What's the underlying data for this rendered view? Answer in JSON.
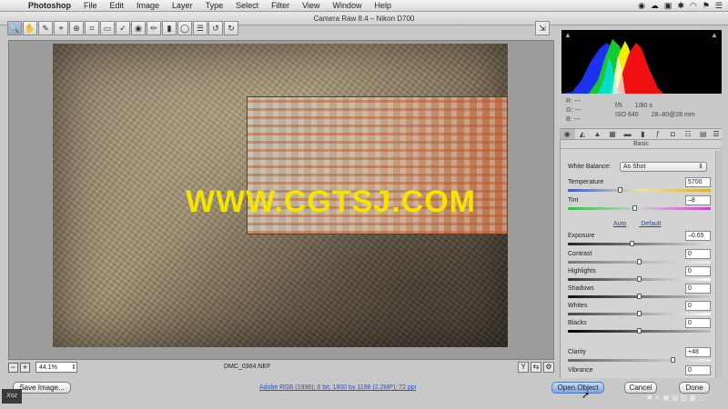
{
  "menubar": {
    "apple": "",
    "app": "Photoshop",
    "items": [
      "File",
      "Edit",
      "Image",
      "Layer",
      "Type",
      "Select",
      "Filter",
      "View",
      "Window",
      "Help"
    ]
  },
  "window": {
    "title": "Camera Raw 8.4  –  Nikon D700"
  },
  "toolbar": {
    "tools": [
      "zoom-tool",
      "hand-tool",
      "white-balance-tool",
      "color-sampler-tool",
      "targeted-adjustment-tool",
      "crop-tool",
      "straighten-tool",
      "spot-removal-tool",
      "red-eye-tool",
      "adjustment-brush",
      "graduated-filter",
      "radial-filter",
      "preferences",
      "rotate-left",
      "rotate-right"
    ],
    "glyphs": [
      "🔍",
      "✋",
      "✎",
      "⌖",
      "⊕",
      "⌗",
      "▭",
      "✓",
      "◉",
      "✏",
      "▮",
      "◯",
      "☰",
      "↺",
      "↻"
    ]
  },
  "watermark": "WWW.CGTSJ.COM",
  "statusbar": {
    "zoom": "44.1%",
    "filename": "DMC_0364.NEF"
  },
  "histogram": {
    "rgb": [
      "R:  ---",
      "G:  ---",
      "B:  ---"
    ],
    "aperture": "f/5",
    "shutter": "1/80 s",
    "iso": "ISO 640",
    "lens": "28–80@28 mm"
  },
  "panel": {
    "title": "Basic",
    "white_balance_label": "White Balance:",
    "white_balance_value": "As Shot",
    "temperature": {
      "label": "Temperature",
      "value": "5700",
      "position": 0.37
    },
    "tint": {
      "label": "Tint",
      "value": "–8",
      "position": 0.47
    },
    "auto": "Auto",
    "default": "Default",
    "exposure": {
      "label": "Exposure",
      "value": "–0.65",
      "position": 0.45
    },
    "contrast": {
      "label": "Contrast",
      "value": "0",
      "position": 0.5
    },
    "highlights": {
      "label": "Highlights",
      "value": "0",
      "position": 0.5
    },
    "shadows": {
      "label": "Shadows",
      "value": "0",
      "position": 0.5
    },
    "whites": {
      "label": "Whites",
      "value": "0",
      "position": 0.5
    },
    "blacks": {
      "label": "Blacks",
      "value": "0",
      "position": 0.5
    },
    "clarity": {
      "label": "Clarity",
      "value": "+48",
      "position": 0.74
    },
    "vibrance": {
      "label": "Vibrance",
      "value": "0",
      "position": 0.5
    }
  },
  "footer": {
    "save_image": "Save Image...",
    "workflow": "Adobe RGB (1998); 8 bit; 1800 by 1198 (2.2MP); 72 ppi",
    "open_object": "Open Object",
    "cancel": "Cancel",
    "done": "Done"
  },
  "logo_text": "Xoz",
  "corner_watermark": "⋯ ✱ ✕ ▣ ▤ ▥ ▦ ⓒ"
}
